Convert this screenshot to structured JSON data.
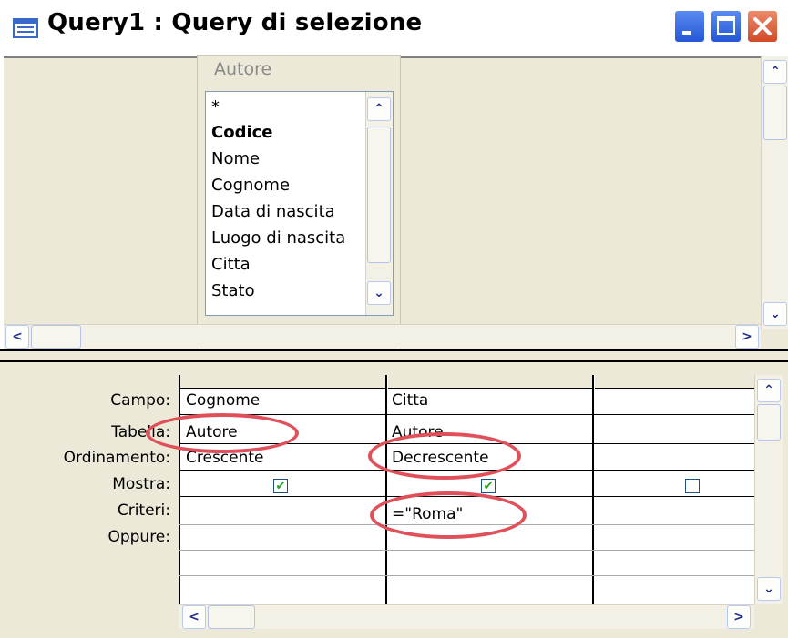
{
  "window": {
    "title": "Query1 : Query di selezione"
  },
  "table": {
    "name": "Autore",
    "fields": [
      "*",
      "Codice",
      "Nome",
      "Cognome",
      "Data di nascita",
      "Luogo di nascita",
      "Citta",
      "Stato"
    ],
    "key_field": "Codice"
  },
  "grid": {
    "row_labels": [
      "Campo:",
      "Tabella:",
      "Ordinamento:",
      "Mostra:",
      "Criteri:",
      "Oppure:"
    ],
    "columns": [
      {
        "campo": "Cognome",
        "tabella": "Autore",
        "ordinamento": "Crescente",
        "mostra": true,
        "criteri": ""
      },
      {
        "campo": "Citta",
        "tabella": "Autore",
        "ordinamento": "Decrescente",
        "mostra": true,
        "criteri": "=\"Roma\""
      },
      {
        "campo": "",
        "tabella": "",
        "ordinamento": "",
        "mostra": false,
        "criteri": ""
      }
    ]
  },
  "colors": {
    "highlight_ellipse": "#e0505a",
    "panel": "#ece9d8",
    "close_button": "#d24a26",
    "title_buttons": "#2457d6"
  },
  "icons": {
    "title": "query-window-icon",
    "minimize": "minimize-icon",
    "maximize": "maximize-icon",
    "close": "close-icon"
  }
}
